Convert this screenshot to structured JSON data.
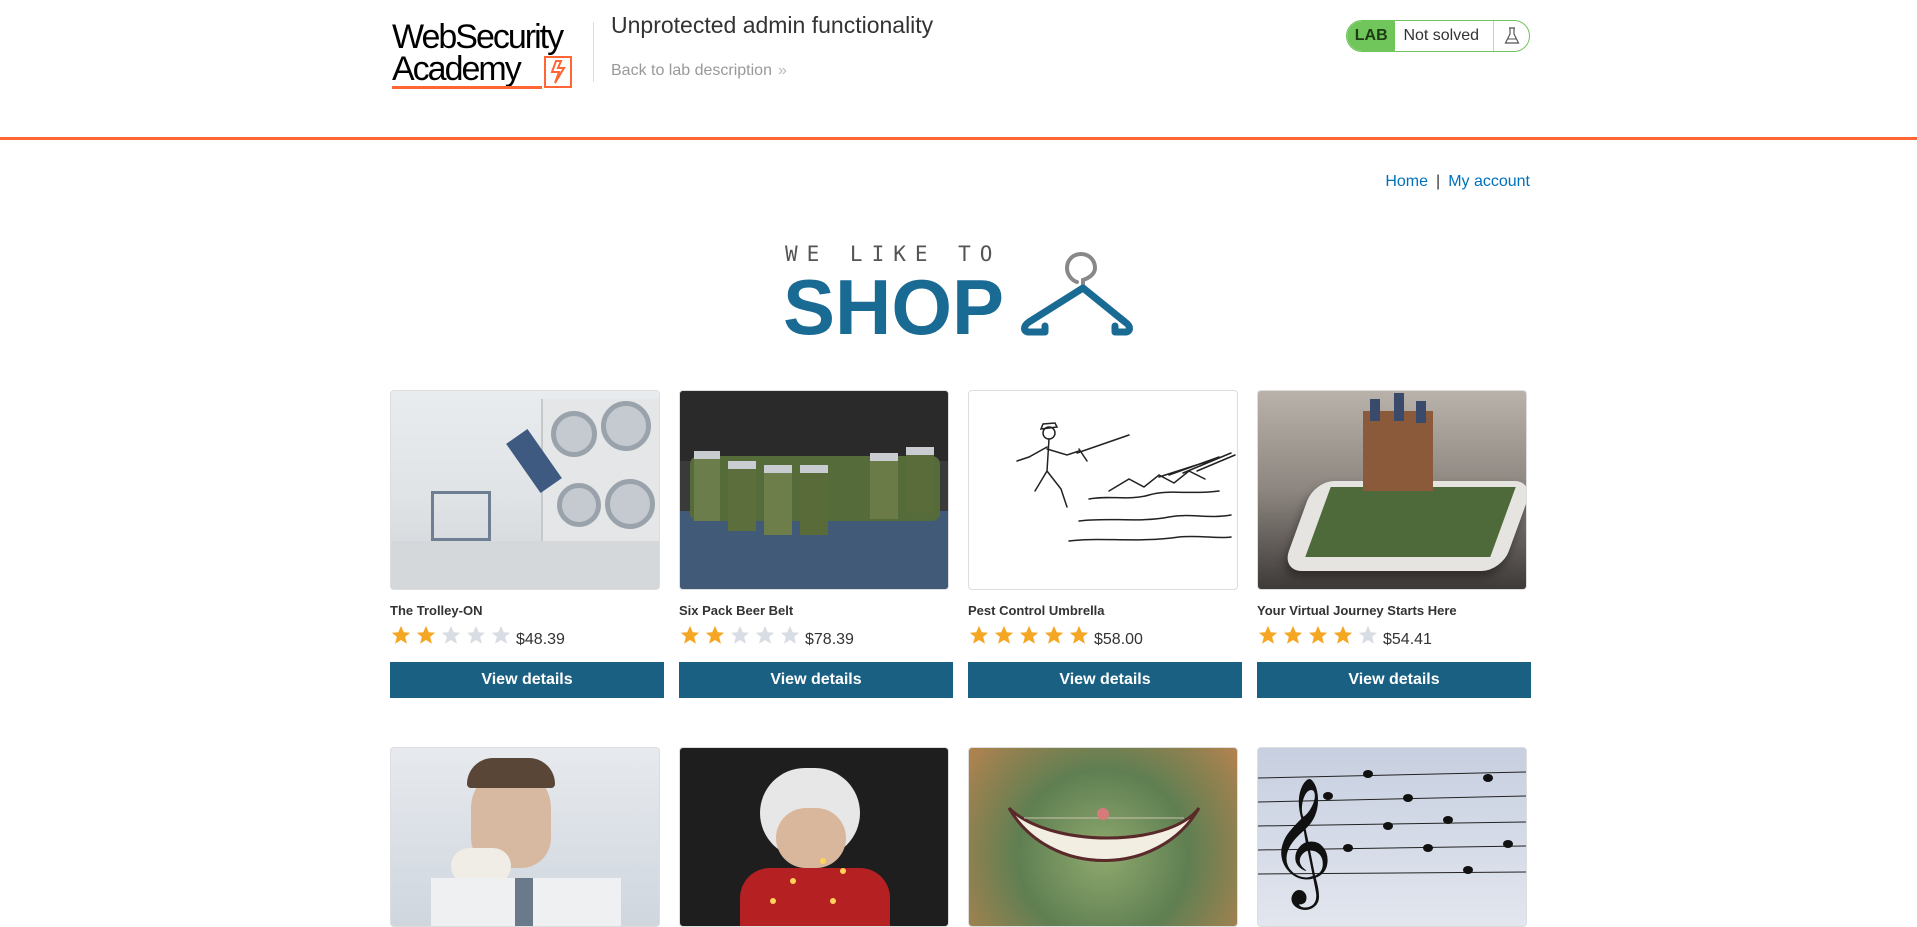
{
  "header": {
    "logo_line1": "WebSecurity",
    "logo_line2": "Academy",
    "lab_title": "Unprotected admin functionality",
    "back_link": "Back to lab description",
    "lab_badge": "LAB",
    "lab_status": "Not solved"
  },
  "nav": {
    "home": "Home",
    "separator": "|",
    "my_account": "My account"
  },
  "hero": {
    "small_text": "WE LIKE TO",
    "big_text": "SHOP"
  },
  "colors": {
    "accent_orange": "#ff6633",
    "brand_blue": "#1a6083",
    "star_gold": "#f5a623",
    "star_gray": "#d8dde3",
    "badge_green": "#70c65b"
  },
  "products": [
    {
      "name": "The Trolley-ON",
      "rating": 2,
      "price": "$48.39",
      "button": "View details",
      "image": "laundromat-photo"
    },
    {
      "name": "Six Pack Beer Belt",
      "rating": 2,
      "price": "$78.39",
      "button": "View details",
      "image": "beer-belt-photo"
    },
    {
      "name": "Pest Control Umbrella",
      "rating": 5,
      "price": "$58.00",
      "button": "View details",
      "image": "umbrella-sketch"
    },
    {
      "name": "Your Virtual Journey Starts Here",
      "rating": 4,
      "price": "$54.41",
      "button": "View details",
      "image": "castle-phone-photo"
    },
    {
      "image": "man-eating-photo"
    },
    {
      "image": "santa-lights-photo"
    },
    {
      "image": "grin-illustration"
    },
    {
      "image": "music-staff-birds-photo"
    }
  ]
}
